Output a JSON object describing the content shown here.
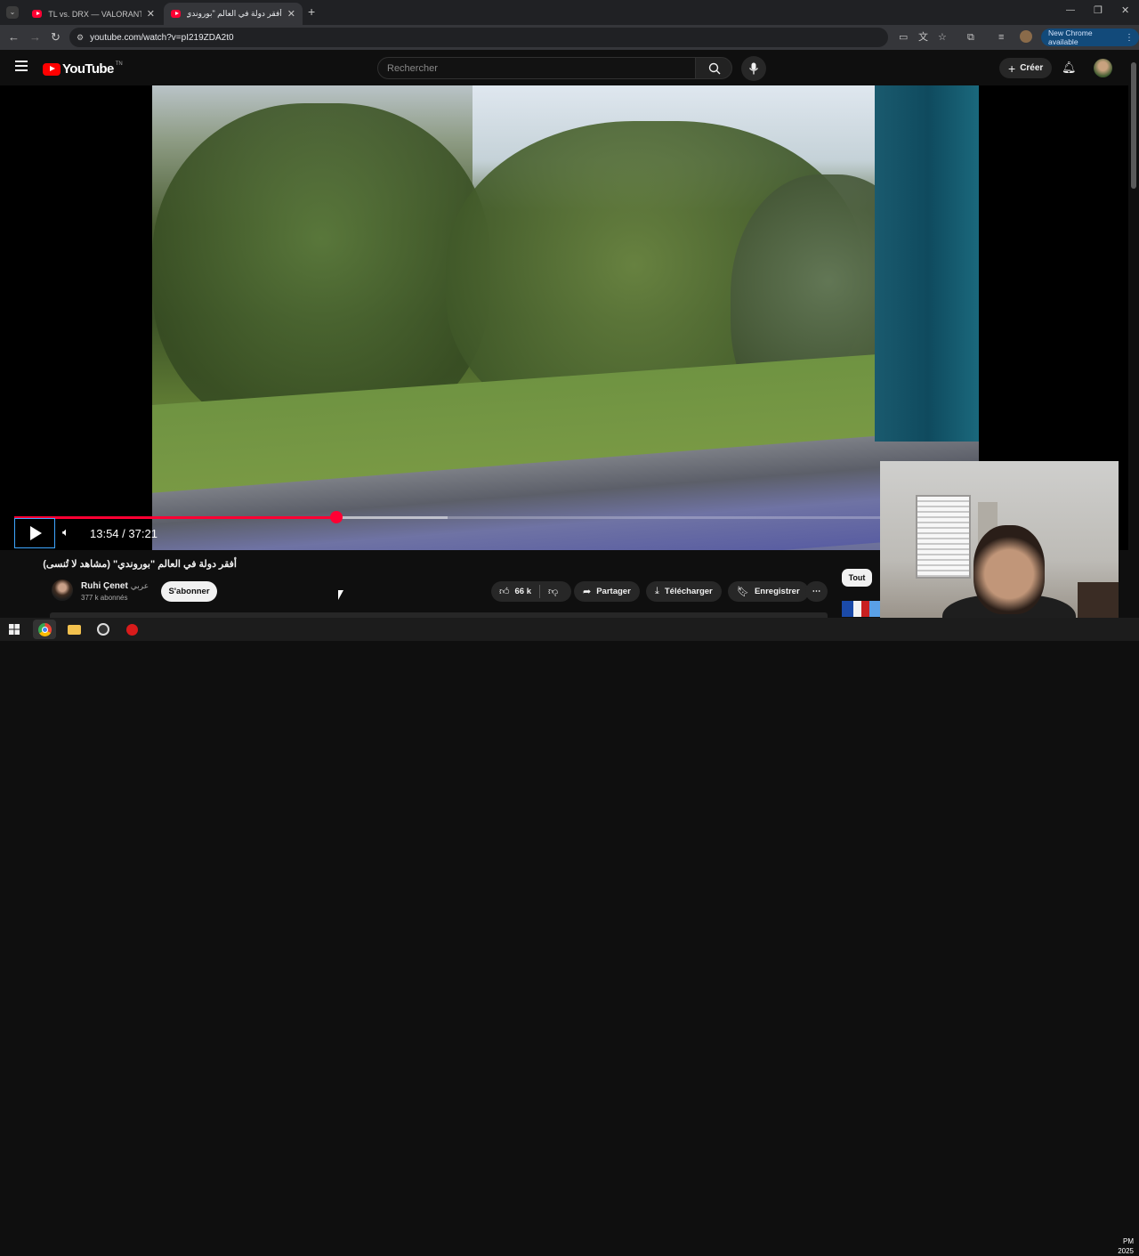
{
  "browser": {
    "tabs": [
      {
        "title": "TL vs. DRX — VALORANT Champ",
        "active": false
      },
      {
        "title": "أفقر دولة في العالم \"بوروندي\" (م...",
        "active": true
      }
    ],
    "url": "youtube.com/watch?v=pI219ZDA2t0",
    "new_chrome": "New Chrome available"
  },
  "youtube": {
    "logo_text": "YouTube",
    "logo_suffix": "TN",
    "search_placeholder": "Rechercher",
    "create_label": "Créer"
  },
  "player": {
    "time_current": "13:54",
    "time_total": "37:21",
    "progress_fraction": 0.372,
    "buffered_fraction": 0.5
  },
  "video": {
    "title": "أفقر دولة في العالم \"بوروندي\" (مشاهد لا تُنسى)",
    "channel_name": "Ruhi Çenet",
    "channel_tag": "عربي",
    "subscribers": "377 k abonnés",
    "subscribe_label": "S'abonner",
    "likes": "66 k",
    "share_label": "Partager",
    "download_label": "Télécharger",
    "save_label": "Enregistrer"
  },
  "sidebar": {
    "chip_all": "Tout"
  },
  "taskbar": {
    "clock_top": "PM",
    "clock_bottom": "2025"
  },
  "colors": {
    "accent_red": "#ff0033",
    "background": "#0f0f0f",
    "focus_outline": "#3ea6ff"
  }
}
